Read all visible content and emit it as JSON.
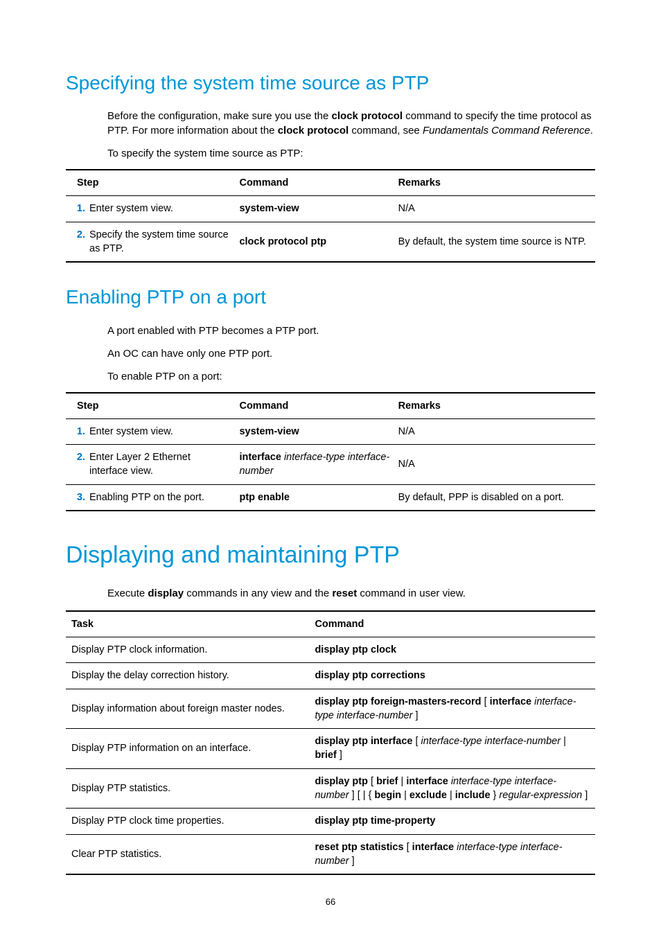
{
  "section1": {
    "heading": "Specifying the system time source as PTP",
    "para1_a": "Before the configuration, make sure you use the ",
    "para1_b": "clock protocol",
    "para1_c": " command to specify the time protocol as PTP. For more information about the ",
    "para1_d": "clock protocol",
    "para1_e": " command, see ",
    "para1_f": "Fundamentals Command Reference",
    "para1_g": ".",
    "para2": "To specify the system time source as PTP:",
    "table_head": {
      "step": "Step",
      "command": "Command",
      "remarks": "Remarks"
    },
    "rows": [
      {
        "num": "1.",
        "step": "Enter system view.",
        "cmd_bold": "system-view",
        "remarks": "N/A"
      },
      {
        "num": "2.",
        "step": "Specify the system time source as PTP.",
        "cmd_bold": "clock protocol ptp",
        "remarks": "By default, the system time source is NTP."
      }
    ]
  },
  "section2": {
    "heading": "Enabling PTP on a port",
    "para1": "A port enabled with PTP becomes a PTP port.",
    "para2": "An OC can have only one PTP port.",
    "para3": "To enable PTP on a port:",
    "table_head": {
      "step": "Step",
      "command": "Command",
      "remarks": "Remarks"
    },
    "rows": [
      {
        "num": "1.",
        "step": "Enter system view.",
        "cmd_bold": "system-view",
        "cmd_ital": "",
        "remarks": "N/A"
      },
      {
        "num": "2.",
        "step": "Enter Layer 2 Ethernet interface view.",
        "cmd_bold": "interface",
        "cmd_ital": " interface-type interface-number",
        "remarks": "N/A"
      },
      {
        "num": "3.",
        "step": "Enabling PTP on the port.",
        "cmd_bold": "ptp enable",
        "cmd_ital": "",
        "remarks": "By default, PPP is disabled on a port."
      }
    ]
  },
  "section3": {
    "heading": "Displaying and maintaining PTP",
    "para1_a": "Execute ",
    "para1_b": "display",
    "para1_c": " commands in any view and the ",
    "para1_d": "reset",
    "para1_e": " command in user view.",
    "table_head": {
      "task": "Task",
      "command": "Command"
    },
    "rows": [
      {
        "task": "Display PTP clock information.",
        "cmd": [
          {
            "b": "display ptp clock"
          }
        ]
      },
      {
        "task": "Display the delay correction history.",
        "cmd": [
          {
            "b": "display ptp corrections"
          }
        ]
      },
      {
        "task": "Display information about foreign master nodes.",
        "cmd": [
          {
            "b": "display ptp foreign-masters-record"
          },
          {
            "t": " [ "
          },
          {
            "b": "interface"
          },
          {
            "t": " "
          },
          {
            "i": "interface-type interface-number"
          },
          {
            "t": " ]"
          }
        ]
      },
      {
        "task": "Display PTP information on an interface.",
        "cmd": [
          {
            "b": "display ptp interface"
          },
          {
            "t": " [ "
          },
          {
            "i": "interface-type interface-number"
          },
          {
            "t": " | "
          },
          {
            "b": "brief"
          },
          {
            "t": " ]"
          }
        ]
      },
      {
        "task": "Display PTP statistics.",
        "cmd": [
          {
            "b": "display ptp"
          },
          {
            "t": " [ "
          },
          {
            "b": "brief"
          },
          {
            "t": " | "
          },
          {
            "b": "interface"
          },
          {
            "t": " "
          },
          {
            "i": "interface-type interface-number"
          },
          {
            "t": " ] [ | { "
          },
          {
            "b": "begin"
          },
          {
            "t": " | "
          },
          {
            "b": "exclude"
          },
          {
            "t": " | "
          },
          {
            "b": "include"
          },
          {
            "t": " } "
          },
          {
            "i": "regular-expression"
          },
          {
            "t": " ]"
          }
        ]
      },
      {
        "task": "Display PTP clock time properties.",
        "cmd": [
          {
            "b": "display ptp time-property"
          }
        ]
      },
      {
        "task": "Clear PTP statistics.",
        "cmd": [
          {
            "b": "reset ptp statistics"
          },
          {
            "t": " [ "
          },
          {
            "b": "interface"
          },
          {
            "t": " "
          },
          {
            "i": "interface-type interface-number"
          },
          {
            "t": " ]"
          }
        ]
      }
    ]
  },
  "page_number": "66"
}
